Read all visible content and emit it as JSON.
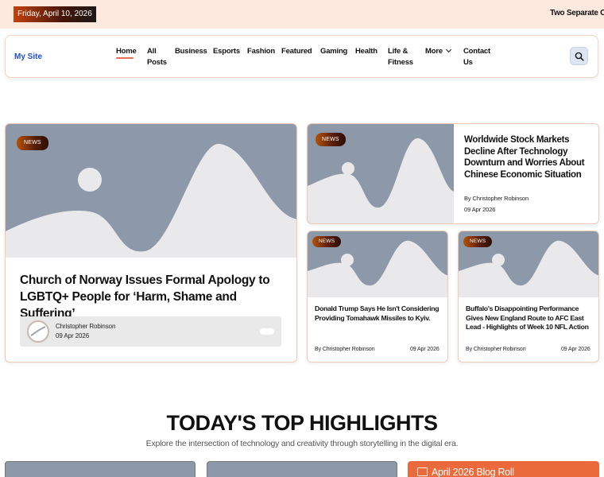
{
  "topbar": {
    "date": "Friday, April 10, 2026",
    "ticker": "Two Separate Cub"
  },
  "header": {
    "site_title": "My Site",
    "nav": [
      {
        "label": "Home",
        "active": true
      },
      {
        "label": "All\nPosts"
      },
      {
        "label": "Business"
      },
      {
        "label": "Esports"
      },
      {
        "label": "Fashion"
      },
      {
        "label": "Featured"
      },
      {
        "label": "Gaming"
      },
      {
        "label": "Health"
      },
      {
        "label": "Life &\nFitness"
      },
      {
        "label": "More",
        "dropdown": true
      },
      {
        "label": "Contact\nUs"
      }
    ],
    "search_icon": "search-icon"
  },
  "featured": {
    "badge": "NEWS",
    "title": "Church of Norway Issues Formal Apology to LGBTQ+ People for ‘Harm, Shame and Suffering’",
    "author": "Christopher Robinson",
    "date": "09 Apr 2026"
  },
  "side_top": {
    "badge": "NEWS",
    "title": "Worldwide Stock Markets Decline After Technology Downturn and Worries About Chinese Economic Situation",
    "author": "By Christopher Robinson",
    "date": "09 Apr 2026"
  },
  "small_cards": [
    {
      "badge": "NEWS",
      "title": "Donald Trump Says He Isn't Considering Providing Tomahawk Missiles to Kyiv.",
      "author": "By Christopher Robinson",
      "date": "09 Apr 2026"
    },
    {
      "badge": "NEWS",
      "title": "Buffalo's Disappointing Performance Gives New England Route to AFC East Lead - Highlights of Week 10 NFL Action",
      "author": "By Christopher Robinson",
      "date": "09 Apr 2026"
    }
  ],
  "highlights": {
    "title": "TODAY'S TOP HIGHLIGHTS",
    "subtitle": "Explore the intersection of technology and creativity through storytelling in the digital era.",
    "blogroll": "April 2026 Blog Roll"
  },
  "colors": {
    "accent": "#e76f51",
    "placeholder": "#8d99a8",
    "topbar_bg": "#fde9dd"
  }
}
